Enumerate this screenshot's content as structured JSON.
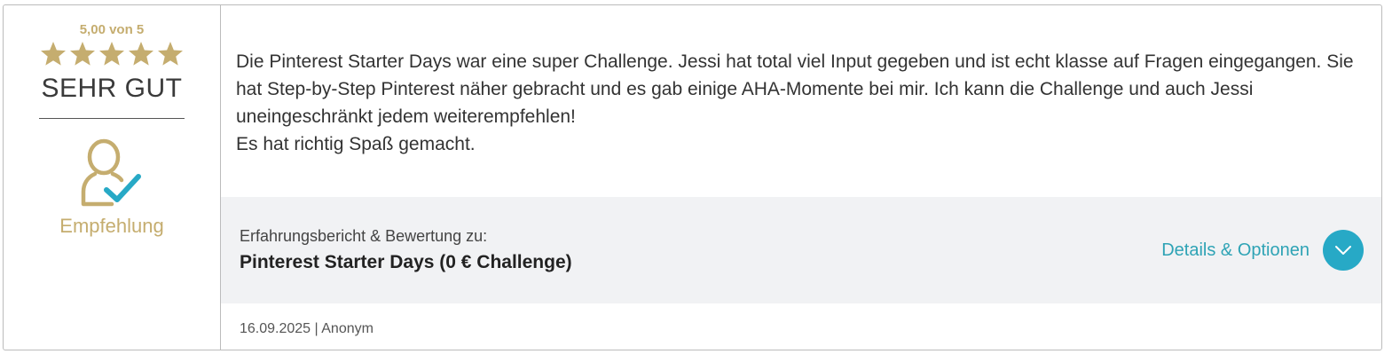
{
  "rating": {
    "score_text": "5,00 von 5",
    "stars": 5,
    "stars_max": 5,
    "verdict": "SEHR GUT",
    "recommendation_label": "Empfehlung"
  },
  "review": {
    "paragraph1": "Die Pinterest Starter Days war eine super Challenge. Jessi hat total viel Input gegeben und ist echt klasse auf Fragen eingegangen. Sie hat Step-by-Step Pinterest näher gebracht und es gab einige AHA-Momente bei mir. Ich kann die Challenge und auch Jessi uneingeschränkt jedem weiterempfehlen!",
    "paragraph2": "Es hat richtig Spaß gemacht."
  },
  "product": {
    "label": "Erfahrungsbericht & Bewertung zu:",
    "name": "Pinterest Starter Days (0 € Challenge)"
  },
  "details": {
    "label": "Details & Optionen",
    "icon": "chevron-down-icon"
  },
  "meta": {
    "text": "16.09.2025 | Anonym"
  },
  "colors": {
    "gold": "#c5ad6f",
    "accent": "#27a9c6",
    "band": "#f1f2f4"
  }
}
